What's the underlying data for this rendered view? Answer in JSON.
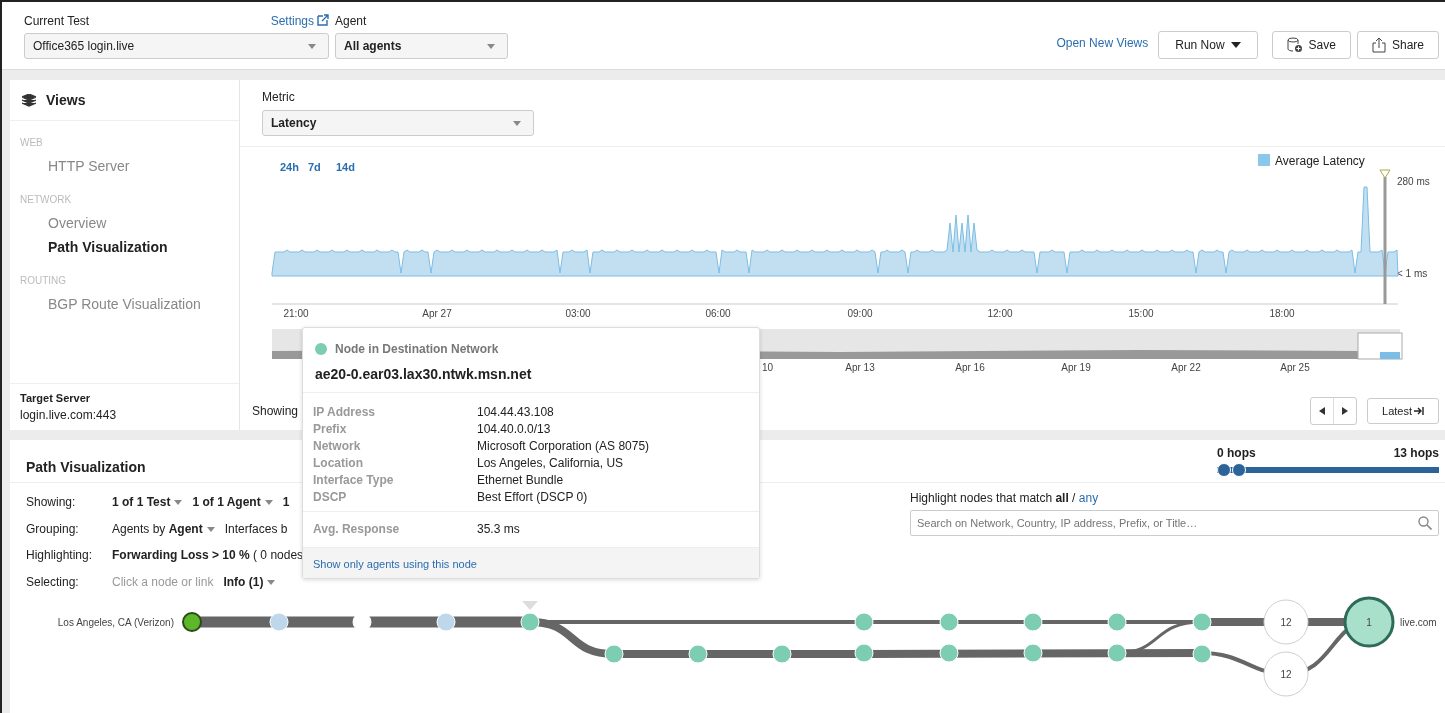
{
  "header": {
    "current_test": {
      "label": "Current Test",
      "value": "Office365 login.live"
    },
    "settings_link": "Settings",
    "agent": {
      "label": "Agent",
      "value": "All agents"
    },
    "open_new_views": "Open New Views",
    "buttons": [
      {
        "kind": "dropdown",
        "label": "Run Now"
      },
      {
        "kind": "save",
        "label": "Save"
      },
      {
        "kind": "share",
        "label": "Share"
      }
    ]
  },
  "sidebar": {
    "title": "Views",
    "sections": [
      {
        "heading": "WEB",
        "items": [
          {
            "label": "HTTP Server",
            "selected": false
          }
        ]
      },
      {
        "heading": "NETWORK",
        "items": [
          {
            "label": "Overview",
            "selected": false
          },
          {
            "label": "Path Visualization",
            "selected": true
          }
        ]
      },
      {
        "heading": "ROUTING",
        "items": [
          {
            "label": "BGP Route Visualization",
            "selected": false
          }
        ]
      }
    ],
    "target_server": {
      "label": "Target Server",
      "value": "login.live.com:443"
    }
  },
  "metric": {
    "label": "Metric",
    "value": "Latency"
  },
  "timeline": {
    "ranges": [
      "24h",
      "7d",
      "14d"
    ],
    "legend": "Average Latency",
    "y_labels": [
      "280 ms",
      "< 1 ms"
    ],
    "x_labels": [
      "21:00",
      "Apr 27",
      "03:00",
      "06:00",
      "09:00",
      "12:00",
      "15:00",
      "18:00"
    ],
    "overview_labels": [
      "10",
      "Apr 13",
      "Apr 16",
      "Apr 19",
      "Apr 22",
      "Apr 25"
    ],
    "showing": "Showing",
    "latest_button": "Latest"
  },
  "path_visualization": {
    "title": "Path Visualization",
    "hops": {
      "min_label": "0 hops",
      "max_label": "13 hops",
      "thumbs": [
        {
          "level": 0
        },
        {
          "level": 0.07
        }
      ]
    },
    "controls": [
      {
        "label": "Showing:",
        "parts": [
          {
            "text": "1 of 1 Test",
            "kind": "menu",
            "caret": true
          },
          {
            "text": "1 of 1 Agent",
            "kind": "menu",
            "caret": true
          },
          {
            "text": "1",
            "kind": "menu",
            "caret": false
          }
        ]
      },
      {
        "label": "Grouping:",
        "parts": [
          {
            "text": "Agents by **Agent**",
            "kind": "option",
            "caret": true
          },
          {
            "text": "Interfaces b",
            "kind": "option",
            "caret": false
          }
        ]
      },
      {
        "label": "Highlighting:",
        "parts": [
          {
            "text": "**Forwarding Loss > 10 %** ( 0 nodes",
            "kind": "option",
            "caret": false
          }
        ]
      },
      {
        "label": "Selecting:",
        "parts": [
          {
            "text": "Click a node or link",
            "kind": "hint",
            "caret": false
          },
          {
            "text": "Info (1)",
            "kind": "menu",
            "caret": true
          }
        ]
      }
    ],
    "highlight": {
      "label": "Highlight nodes that match **all** / ",
      "link": "any",
      "placeholder": "Search on Network, Country, IP address, Prefix, or Title…"
    },
    "source_label": "Los Angeles, CA (Verizon)",
    "destination_label": "live.com",
    "nodes": [
      {
        "kind": "agent",
        "color": "#5cb82a"
      },
      {
        "kind": "hop",
        "color": "#bfd7ea"
      },
      {
        "kind": "hop",
        "color": "#ffffff"
      },
      {
        "kind": "hop",
        "color": "#bfd7ea"
      },
      {
        "kind": "hop",
        "color": "#7dcdb2"
      },
      {
        "kind": "hop",
        "color": "#7dcdb2"
      },
      {
        "kind": "hop",
        "color": "#7dcdb2"
      },
      {
        "kind": "hop",
        "color": "#7dcdb2"
      },
      {
        "kind": "hop",
        "color": "#7dcdb2"
      },
      {
        "kind": "hop",
        "color": "#7dcdb2"
      },
      {
        "kind": "hop",
        "color": "#7dcdb2"
      },
      {
        "kind": "hop",
        "color": "#7dcdb2"
      },
      {
        "kind": "hop",
        "color": "#7dcdb2"
      },
      {
        "kind": "hop",
        "color": "#7dcdb2"
      },
      {
        "kind": "hop",
        "color": "#7dcdb2"
      },
      {
        "kind": "hop",
        "color": "#7dcdb2"
      },
      {
        "kind": "hop",
        "color": "#7dcdb2"
      },
      {
        "kind": "hop",
        "color": "#7dcdb2"
      },
      {
        "kind": "group",
        "color": "#ffffff",
        "count": "12"
      },
      {
        "kind": "group",
        "color": "#ffffff",
        "count": "12"
      },
      {
        "kind": "destination",
        "color": "#a8e0cc",
        "count": "1"
      }
    ]
  },
  "tooltip": {
    "color": "#7dcdb2",
    "type": "Node in Destination Network",
    "host": "ae20-0.ear03.lax30.ntwk.msn.net",
    "fields": [
      {
        "label": "IP Address",
        "value": "104.44.43.108"
      },
      {
        "label": "Prefix",
        "value": "104.40.0.0/13"
      },
      {
        "label": "Network",
        "value": "Microsoft Corporation (AS 8075)"
      },
      {
        "label": "Location",
        "value": "Los Angeles, California, US"
      },
      {
        "label": "Interface Type",
        "value": "Ethernet Bundle"
      },
      {
        "label": "DSCP",
        "value": "Best Effort (DSCP 0)"
      }
    ],
    "response": {
      "label": "Avg. Response",
      "value": "35.3 ms"
    },
    "link": "Show only agents using this node"
  }
}
